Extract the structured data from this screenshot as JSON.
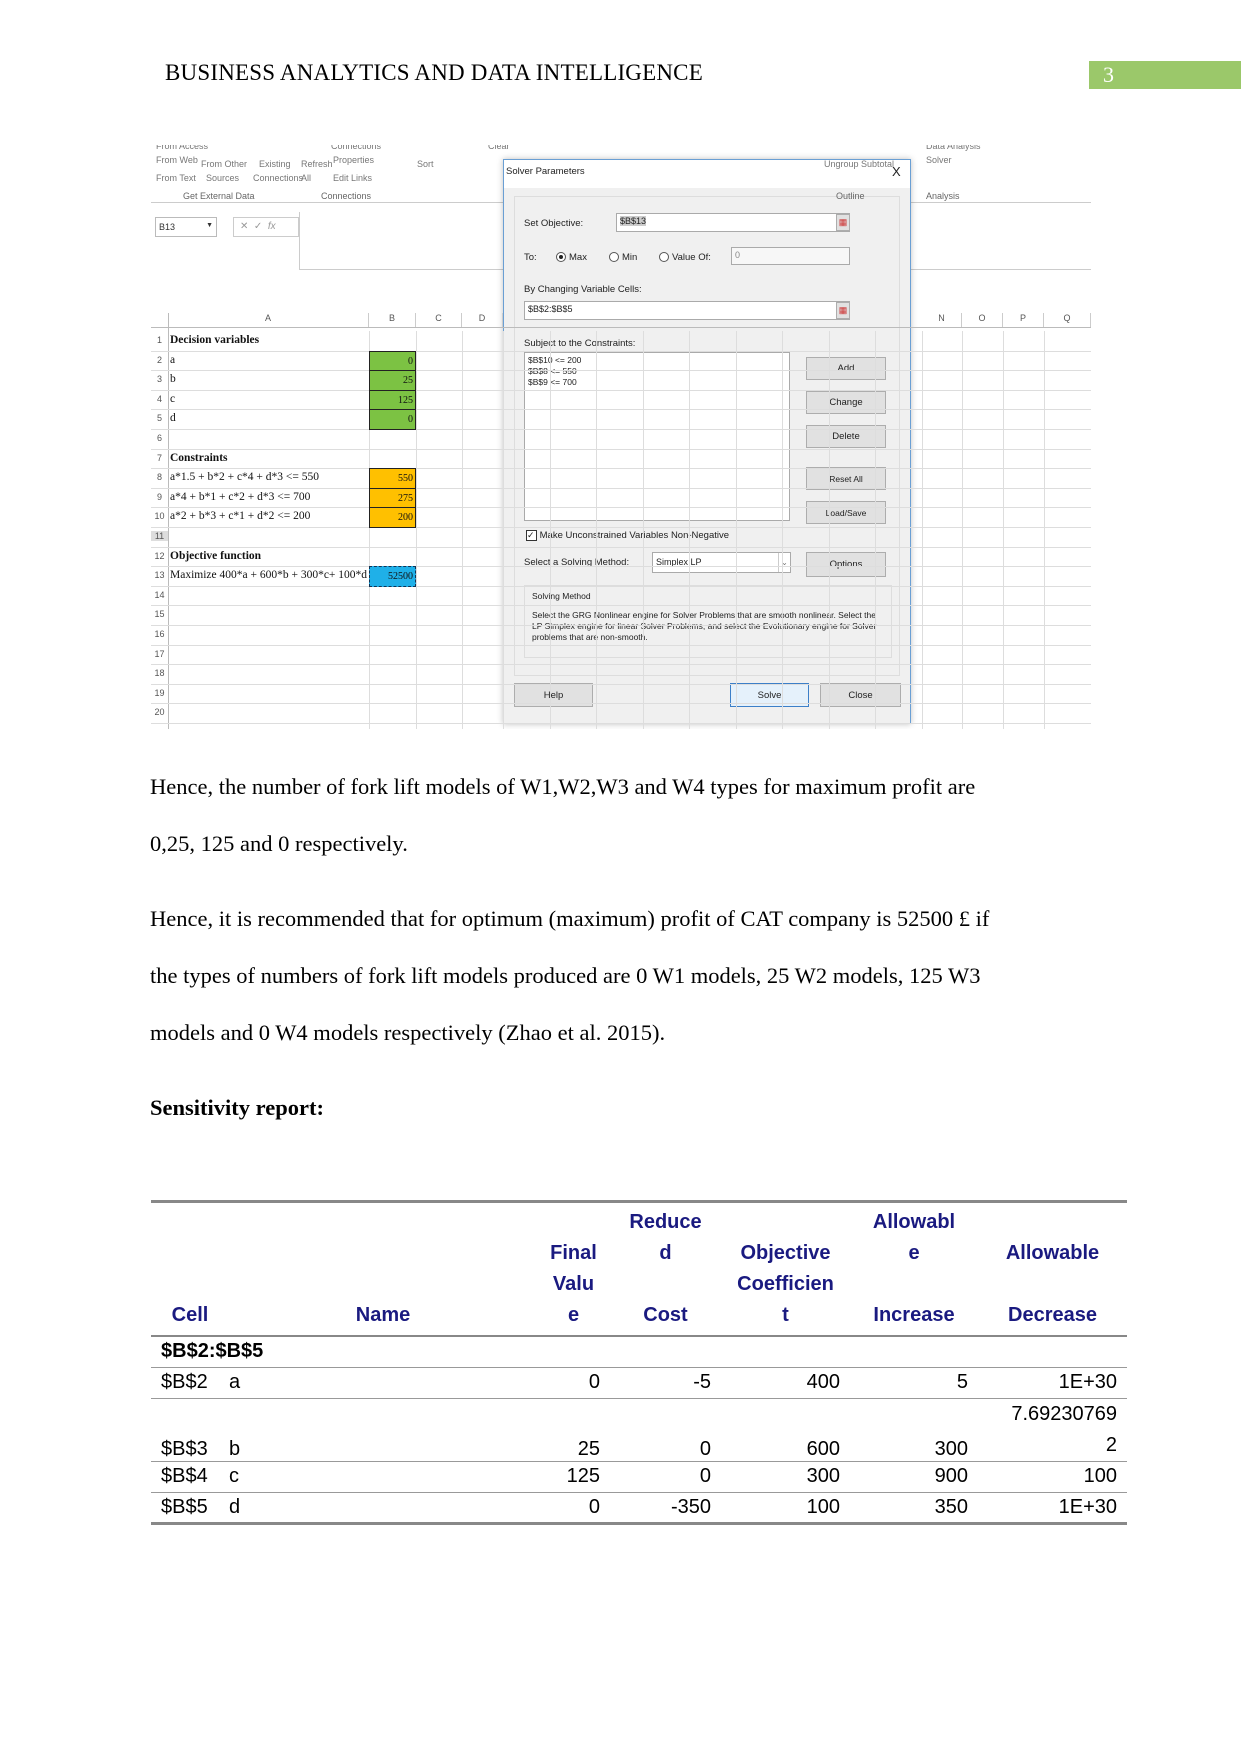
{
  "header": {
    "title": "BUSINESS ANALYTICS AND DATA INTELLIGENCE",
    "page_number": "3",
    "accent": "#9bc86a"
  },
  "excel": {
    "ribbon": {
      "items": [
        "From Access",
        "From Web",
        "From Text",
        "From Other",
        "Sources",
        "Existing",
        "Connections",
        "Refresh",
        "All",
        "Connections",
        "Properties",
        "Edit Links",
        "Sort",
        "Clear",
        "Ungroup",
        "Subtotal",
        "Data Analysis",
        "Solver"
      ],
      "groups": [
        "Get External Data",
        "Connections",
        "Outline",
        "Analysis"
      ]
    },
    "name_box": "B13",
    "fx": "fx",
    "columns": [
      "A",
      "B",
      "C",
      "D",
      "N",
      "O",
      "P",
      "Q"
    ],
    "rows": [
      {
        "n": "1",
        "a": "Decision variables",
        "b": "",
        "bold": true
      },
      {
        "n": "2",
        "a": "a",
        "b": "0",
        "fill": "#7cc243"
      },
      {
        "n": "3",
        "a": "b",
        "b": "25",
        "fill": "#7cc243"
      },
      {
        "n": "4",
        "a": "c",
        "b": "125",
        "fill": "#7cc243"
      },
      {
        "n": "5",
        "a": "d",
        "b": "0",
        "fill": "#7cc243"
      },
      {
        "n": "6",
        "a": "",
        "b": ""
      },
      {
        "n": "7",
        "a": "Constraints",
        "b": "",
        "bold": true
      },
      {
        "n": "8",
        "a": "a*1.5 + b*2 + c*4 + d*3 <= 550",
        "b": "550",
        "fill": "#ffc000"
      },
      {
        "n": "9",
        "a": "a*4 + b*1 + c*2 + d*3 <= 700",
        "b": "275",
        "fill": "#ffc000"
      },
      {
        "n": "10",
        "a": "a*2 + b*3 + c*1 + d*2 <= 200",
        "b": "200",
        "fill": "#ffc000"
      },
      {
        "n": "11",
        "a": "",
        "b": ""
      },
      {
        "n": "12",
        "a": "Objective function",
        "b": "",
        "bold": true
      },
      {
        "n": "13",
        "a": "Maximize 400*a + 600*b + 300*c+ 100*d",
        "b": "52500",
        "fill": "#1fb0e8"
      },
      {
        "n": "14",
        "a": "",
        "b": ""
      },
      {
        "n": "15",
        "a": "",
        "b": ""
      },
      {
        "n": "16",
        "a": "",
        "b": ""
      },
      {
        "n": "17",
        "a": "",
        "b": ""
      },
      {
        "n": "18",
        "a": "",
        "b": ""
      },
      {
        "n": "19",
        "a": "",
        "b": ""
      },
      {
        "n": "20",
        "a": "",
        "b": ""
      }
    ],
    "dialog": {
      "title": "Solver Parameters",
      "close": "X",
      "set_objective_label": "Set Objective:",
      "set_objective_value": "$B$13",
      "to_label": "To:",
      "max": "Max",
      "min": "Min",
      "value_of": "Value Of:",
      "value_of_value": "0",
      "selected": "Max",
      "changing_label": "By Changing Variable Cells:",
      "changing_value": "$B$2:$B$5",
      "constraints_label": "Subject to the Constraints:",
      "constraints": [
        "$B$10 <= 200",
        "$B$8 <= 550",
        "$B$9 <= 700"
      ],
      "buttons": {
        "add": "Add",
        "change": "Change",
        "delete": "Delete",
        "reset": "Reset All",
        "load": "Load/Save",
        "options": "Options",
        "help": "Help",
        "solve": "Solve",
        "close": "Close"
      },
      "nonneg_label": "Make Unconstrained Variables Non-Negative",
      "nonneg_checked": true,
      "method_label": "Select a Solving Method:",
      "method_value": "Simplex LP",
      "method_box_title": "Solving Method",
      "method_box_text": "Select the GRG Nonlinear engine for Solver Problems that are smooth nonlinear. Select the LP Simplex engine for linear Solver Problems, and select the Evolutionary engine for Solver problems that are non-smooth."
    }
  },
  "body": {
    "p1_line1": "Hence, the number of fork lift models of W1,W2,W3 and W4 types for maximum profit are",
    "p1_line2": "0,25, 125 and 0 respectively.",
    "p2_line1": "Hence, it is recommended that for optimum (maximum) profit of CAT company is 52500 £ if",
    "p2_line2": "the types of numbers of fork lift models produced are 0 W1 models, 25 W2 models, 125 W3",
    "p2_line3": "models and 0 W4 models respectively (Zhao et al. 2015).",
    "heading": "Sensitivity report:"
  },
  "sensitivity": {
    "headers": [
      "Cell",
      "Name",
      "Final Value",
      "Reduced Cost",
      "Objective Coefficient",
      "Allowable Increase",
      "Allowable Decrease"
    ],
    "header_lines": [
      [
        "Cell"
      ],
      [
        "Name"
      ],
      [
        "Final",
        "Valu",
        "e"
      ],
      [
        "Reduce",
        "d",
        "",
        "Cost"
      ],
      [
        "",
        "Objective",
        "Coefficien",
        "t"
      ],
      [
        "Allowabl",
        "e",
        "",
        "Increase"
      ],
      [
        "",
        "Allowable",
        "",
        "Decrease"
      ]
    ],
    "group": "$B$2:$B$5",
    "rows": [
      {
        "cell": "$B$2",
        "name": "a",
        "final": "0",
        "reduced": "-5",
        "coef": "400",
        "inc": "5",
        "dec": "1E+30"
      },
      {
        "cell": "$B$3",
        "name": "b",
        "final": "25",
        "reduced": "0",
        "coef": "600",
        "inc": "300",
        "dec": "7.69230769",
        "dec2": "2"
      },
      {
        "cell": "$B$4",
        "name": "c",
        "final": "125",
        "reduced": "0",
        "coef": "300",
        "inc": "900",
        "dec": "100"
      },
      {
        "cell": "$B$5",
        "name": "d",
        "final": "0",
        "reduced": "-350",
        "coef": "100",
        "inc": "350",
        "dec": "1E+30"
      }
    ],
    "header_color": "#1a1a80"
  }
}
